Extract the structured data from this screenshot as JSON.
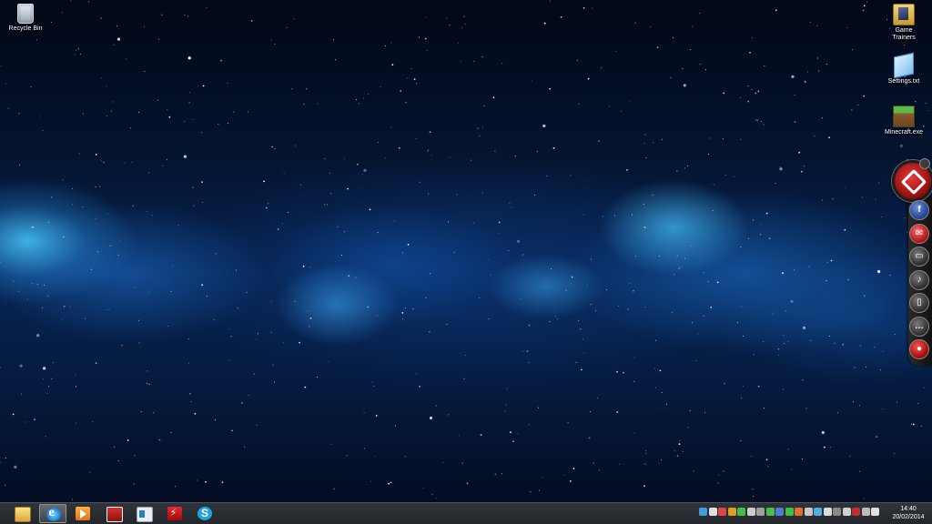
{
  "desktop": {
    "icons": [
      {
        "label": "Recycle Bin",
        "icon": "recycle-bin-icon"
      },
      {
        "label": "Game\nTrainers",
        "icon": "folder-icon"
      },
      {
        "label": "Settings.txt",
        "icon": "text-file-icon"
      },
      {
        "label": "Minecraft.exe",
        "icon": "minecraft-icon"
      }
    ]
  },
  "side_dock": {
    "main_icon": "dock-logo-icon",
    "buttons": [
      {
        "icon": "facebook-icon",
        "glyph": "f",
        "color": "#3b5998"
      },
      {
        "icon": "mail-icon",
        "glyph": "✉",
        "color": "#c0392b"
      },
      {
        "icon": "video-icon",
        "glyph": "▭",
        "color": "#555555"
      },
      {
        "icon": "music-icon",
        "glyph": "♪",
        "color": "#555555"
      },
      {
        "icon": "document-icon",
        "glyph": "▯",
        "color": "#555555"
      },
      {
        "icon": "chat-icon",
        "glyph": "…",
        "color": "#555555"
      },
      {
        "icon": "stop-icon",
        "glyph": "●",
        "color": "#c0392b"
      }
    ]
  },
  "taskbar": {
    "apps": [
      {
        "name": "file-explorer",
        "icon": "folder-icon",
        "active": false
      },
      {
        "name": "internet-explorer",
        "icon": "internet-explorer-icon",
        "active": true
      },
      {
        "name": "media-player",
        "icon": "media-player-icon",
        "active": false
      },
      {
        "name": "red-app",
        "icon": "red-app-icon",
        "active": false
      },
      {
        "name": "window-app",
        "icon": "window-icon",
        "active": false
      },
      {
        "name": "flash-app",
        "icon": "flash-icon",
        "active": false
      },
      {
        "name": "skype",
        "icon": "skype-icon",
        "active": false
      }
    ],
    "tray_colors": [
      "#3aa0e0",
      "#e0e0e0",
      "#e24545",
      "#e0a020",
      "#3fbf4a",
      "#cccccc",
      "#a0a0a0",
      "#45c050",
      "#4d7fd0",
      "#3fbf4a",
      "#e07030",
      "#c8c8c8",
      "#50b0e0",
      "#dddddd",
      "#8a8a8a",
      "#d0d0d0",
      "#c03030",
      "#bbbbbb",
      "#e0e0e0"
    ],
    "clock": {
      "time": "14:40",
      "date": "20/02/2014"
    }
  }
}
